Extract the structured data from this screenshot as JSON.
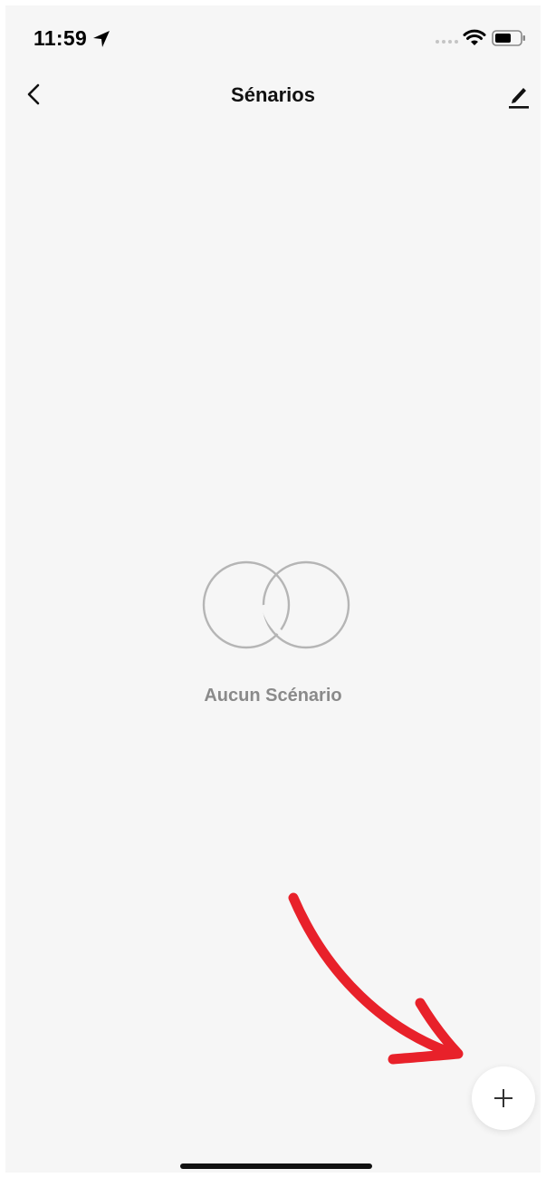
{
  "status_bar": {
    "time": "11:59",
    "icons": [
      "location-arrow-icon",
      "signal-icon",
      "wifi-icon",
      "battery-icon"
    ]
  },
  "nav": {
    "title": "Sénarios",
    "left_icon": "chevron-left-icon",
    "right_icon": "edit-pencil-icon"
  },
  "empty_state": {
    "icon": "overlapping-circles-icon",
    "label": "Aucun Scénario"
  },
  "fab": {
    "icon": "plus-icon"
  },
  "colors": {
    "background": "#f6f6f6",
    "title": "#111111",
    "empty_text": "#8a8a8a",
    "empty_icon": "#b5b5b5",
    "annotation_arrow": "#e8212a"
  }
}
